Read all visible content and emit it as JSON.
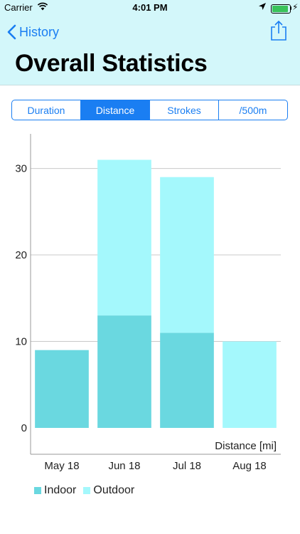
{
  "status_bar": {
    "carrier": "Carrier",
    "time": "4:01 PM"
  },
  "nav": {
    "back_label": "History",
    "title": "Overall Statistics"
  },
  "segments": {
    "items": [
      "Duration",
      "Distance",
      "Strokes",
      "/500m"
    ],
    "selected_index": 1
  },
  "colors": {
    "accent": "#1a7ef2",
    "header_bg": "#d3f7fa",
    "indoor": "#6ad8e0",
    "outdoor": "#a4f8fc"
  },
  "chart_data": {
    "type": "bar",
    "stacked": true,
    "categories": [
      "May 18",
      "Jun 18",
      "Jul 18",
      "Aug 18"
    ],
    "series": [
      {
        "name": "Indoor",
        "values": [
          9,
          13,
          11,
          0
        ]
      },
      {
        "name": "Outdoor",
        "values": [
          0,
          18,
          18,
          10
        ]
      }
    ],
    "xlabel": "Distance [mi]",
    "ylim": [
      0,
      34
    ],
    "yticks": [
      0,
      10,
      20,
      30
    ],
    "grid": true,
    "legend_position": "bottom-left"
  }
}
